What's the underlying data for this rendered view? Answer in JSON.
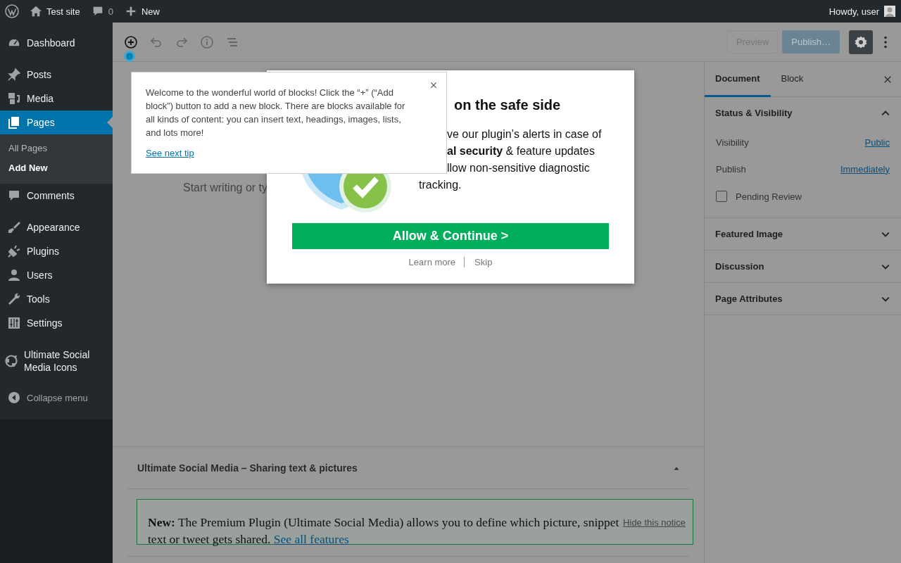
{
  "admin_bar": {
    "site_name": "Test site",
    "comment_count": "0",
    "new_label": "New",
    "greeting": "Howdy, user"
  },
  "menu": {
    "groups": [
      {
        "items": [
          {
            "label": "Dashboard",
            "selected": false
          }
        ]
      },
      {
        "items": [
          {
            "label": "Posts",
            "selected": false
          },
          {
            "label": "Media",
            "selected": false
          },
          {
            "label": "Pages",
            "selected": true,
            "children": [
              {
                "label": "All Pages",
                "selected": false
              },
              {
                "label": "Add New",
                "selected": true
              }
            ]
          },
          {
            "label": "Comments",
            "selected": false
          }
        ]
      },
      {
        "items": [
          {
            "label": "Appearance",
            "selected": false
          },
          {
            "label": "Plugins",
            "selected": false
          },
          {
            "label": "Users",
            "selected": false
          },
          {
            "label": "Tools",
            "selected": false
          },
          {
            "label": "Settings",
            "selected": false
          }
        ]
      },
      {
        "items": [
          {
            "label": "Ultimate Social Media Icons",
            "selected": false
          }
        ]
      }
    ],
    "collapse_label": "Collapse menu"
  },
  "editor_toolbar": {
    "beacon": true,
    "preview_label": "Preview",
    "publish_label": "Publish…",
    "settings_pressed": true
  },
  "settings_sidebar": {
    "tabs": [
      {
        "label": "Document",
        "selected": true
      },
      {
        "label": "Block",
        "selected": false
      }
    ],
    "panels": [
      {
        "title": "Status & Visibility",
        "expanded": true,
        "rows": [
          {
            "label": "Visibility",
            "value": "Public"
          },
          {
            "label": "Publish",
            "value": "Immediately"
          }
        ],
        "checkbox": {
          "label": "Pending Review",
          "checked": false
        }
      },
      {
        "title": "Featured Image",
        "expanded": false
      },
      {
        "title": "Discussion",
        "expanded": false
      },
      {
        "title": "Page Attributes",
        "expanded": false
      }
    ]
  },
  "canvas": {
    "placeholder": "Start writing or ty"
  },
  "meta_box": {
    "title": "Ultimate Social Media – Sharing text & pictures",
    "expanded": true,
    "notice": {
      "text": "**New:** The Premium Plugin (Ultimate Social Media) allows you to define which picture, snippet text or tweet gets shared.",
      "link": "See all features",
      "dismiss": "Hide this notice"
    }
  },
  "modal": {
    "heading": "on the safe side",
    "lines": [
      "ve our plugin’s alerts in case of",
      "**al security** & feature updates",
      "llow non-sensitive diagnostic",
      "tracking."
    ],
    "button": "Allow & Continue >",
    "links": [
      "Learn more",
      "Skip"
    ]
  },
  "tip": {
    "text": "Welcome to the wonderful world of blocks! Click the “+” (“Add block”) button to add a new block. There are blocks available for all kinds of content: you can insert text, headings, images, lists, and lots more!",
    "link": "See next tip"
  }
}
